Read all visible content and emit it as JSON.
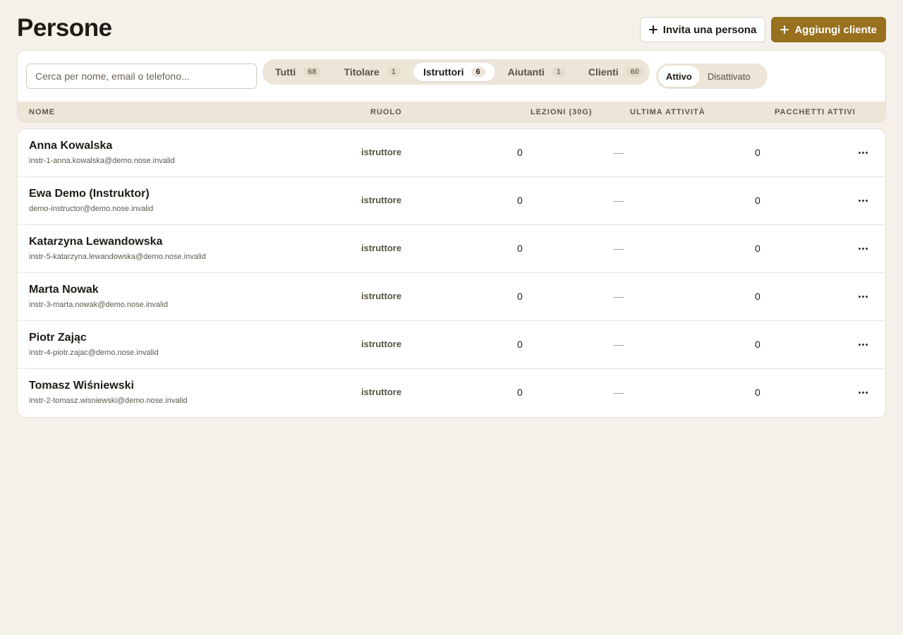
{
  "header": {
    "title": "Persone",
    "invite_label": "Invita una persona",
    "add_client_label": "Aggiungi cliente"
  },
  "search": {
    "placeholder": "Cerca per nome, email o telefono..."
  },
  "role_tabs": [
    {
      "label": "Tutti",
      "count": "68"
    },
    {
      "label": "Titolare",
      "count": "1"
    },
    {
      "label": "Istruttori",
      "count": "6"
    },
    {
      "label": "Aiutanti",
      "count": "1"
    },
    {
      "label": "Clienti",
      "count": "60"
    }
  ],
  "active_role_tab": "Istruttori",
  "status_toggle": {
    "active_label": "Attivo",
    "inactive_label": "Disattivato",
    "selected": "Attivo"
  },
  "columns": {
    "name": "NOME",
    "role": "RUOLO",
    "lessons": "LEZIONI (30G)",
    "last_activity": "ULTIMA ATTIVITÀ",
    "packages": "PACCHETTI ATTIVI"
  },
  "people": [
    {
      "name": "Anna Kowalska",
      "email": "instr-1-anna.kowalska@demo.nose.invalid",
      "role": "istruttore",
      "lessons": "0",
      "last_activity": "—",
      "packages": "0"
    },
    {
      "name": "Ewa Demo (Instruktor)",
      "email": "demo-instructor@demo.nose.invalid",
      "role": "istruttore",
      "lessons": "0",
      "last_activity": "—",
      "packages": "0"
    },
    {
      "name": "Katarzyna Lewandowska",
      "email": "instr-5-katarzyna.lewandowska@demo.nose.invalid",
      "role": "istruttore",
      "lessons": "0",
      "last_activity": "—",
      "packages": "0"
    },
    {
      "name": "Marta Nowak",
      "email": "instr-3-marta.nowak@demo.nose.invalid",
      "role": "istruttore",
      "lessons": "0",
      "last_activity": "—",
      "packages": "0"
    },
    {
      "name": "Piotr Zając",
      "email": "instr-4-piotr.zajac@demo.nose.invalid",
      "role": "istruttore",
      "lessons": "0",
      "last_activity": "—",
      "packages": "0"
    },
    {
      "name": "Tomasz Wiśniewski",
      "email": "instr-2-tomasz.wisniewski@demo.nose.invalid",
      "role": "istruttore",
      "lessons": "0",
      "last_activity": "—",
      "packages": "0"
    }
  ],
  "icons": {
    "add": "plus-icon",
    "row_menu": "more-horizontal-icon"
  },
  "colors": {
    "accent": "#98711f",
    "background": "#f5f1ea",
    "surface_muted": "#ede5d8"
  }
}
